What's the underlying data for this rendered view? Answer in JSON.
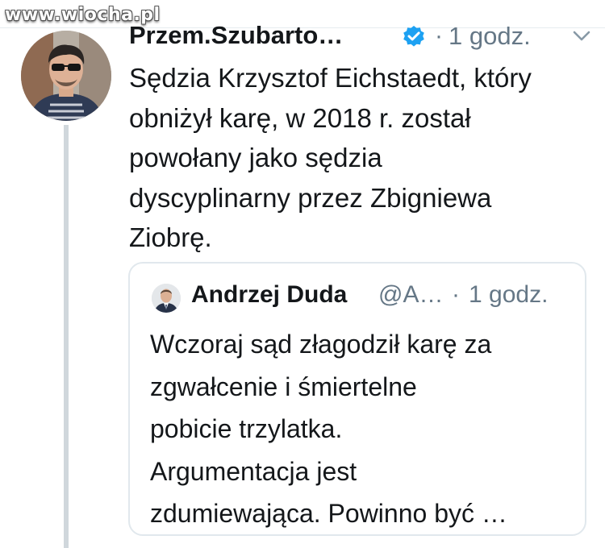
{
  "watermark": "www.wiocha.pl",
  "tweet": {
    "author_name": "Przem.Szubarto…",
    "separator": "·",
    "time": "1 godz.",
    "icons": {
      "verified": "verified-badge-icon",
      "menu": "chevron-down-icon"
    },
    "accent_color": "#1da1f2",
    "text_lines": [
      "Sędzia Krzysztof Eichstaedt, który",
      "obniżył karę, w 2018 r. został",
      "powołany jako sędzia",
      "dyscyplinarny przez Zbigniewa",
      "Ziobrę."
    ]
  },
  "quoted_tweet": {
    "author_name": "Andrzej Duda",
    "handle": "@A…",
    "separator": "·",
    "time": "1 godz.",
    "text_lines": [
      "Wczoraj sąd złagodził karę za",
      "zgwałcenie i śmiertelne",
      "pobicie trzylatka.",
      "Argumentacja jest",
      "zdumiewająca. Powinno być …"
    ]
  }
}
